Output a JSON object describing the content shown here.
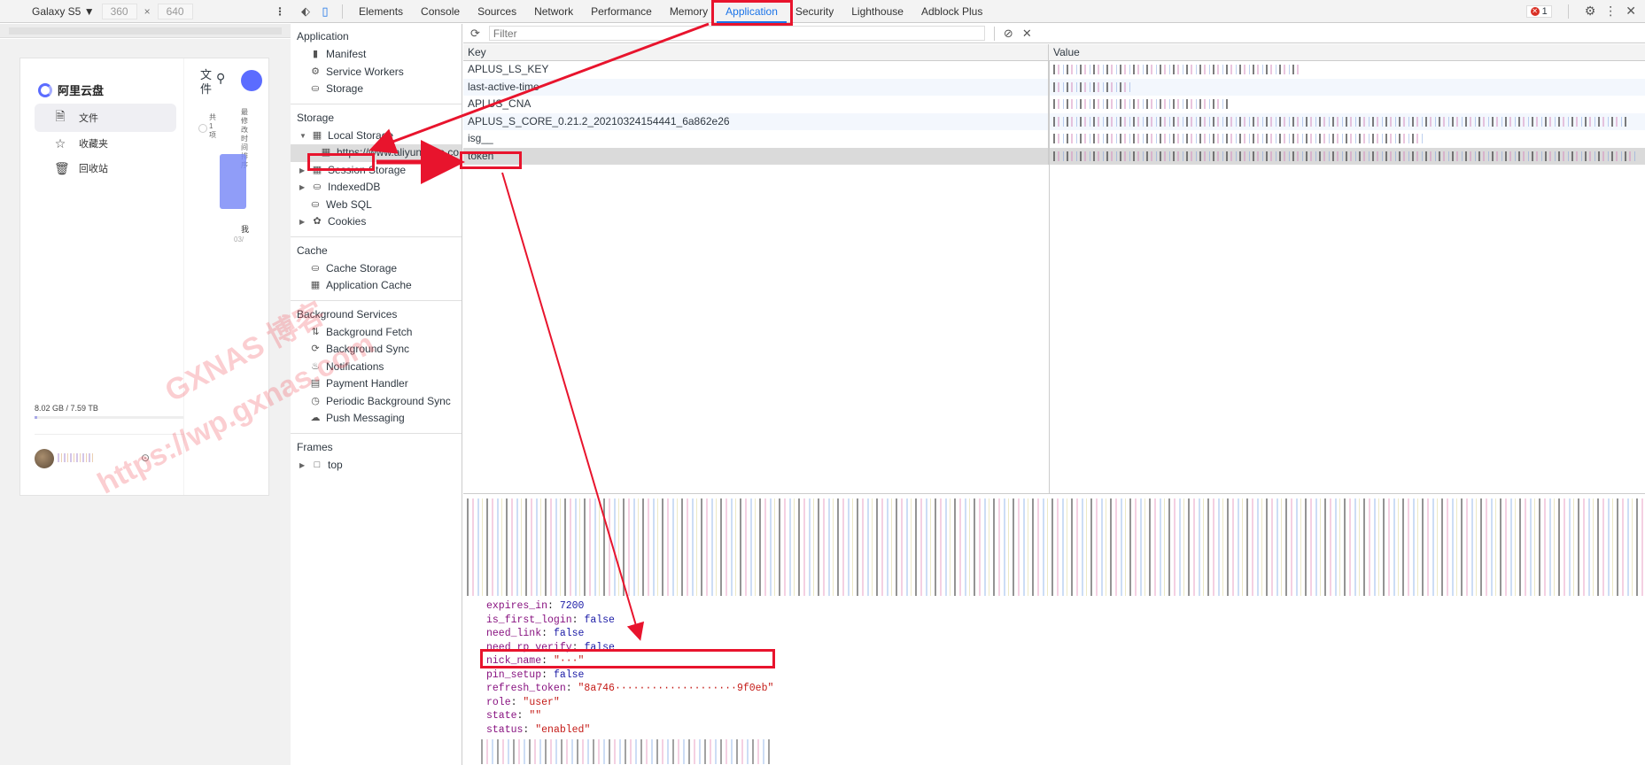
{
  "device_toolbar": {
    "device": "Galaxy S5 ▼",
    "width": "360",
    "times": "×",
    "height": "640",
    "more": "⋮"
  },
  "phone": {
    "brand": "阿里云盘",
    "nav": [
      {
        "label": "文件",
        "icon": "file-icon"
      },
      {
        "label": "收藏夹",
        "icon": "star-icon"
      },
      {
        "label": "回收站",
        "icon": "trash-icon"
      }
    ],
    "header_title": "文件",
    "quota": "8.02 GB / 7.59 TB",
    "quota_fraction": 0.01,
    "side_tiny_a": "共 1 项",
    "side_tiny_b": "最 修 改 时 间 排 序",
    "file_name": "我",
    "file_date": "03/"
  },
  "devtools": {
    "tabs": [
      "Elements",
      "Console",
      "Sources",
      "Network",
      "Performance",
      "Memory",
      "Application",
      "Security",
      "Lighthouse",
      "Adblock Plus"
    ],
    "active_tab": "Application",
    "error_count": "1",
    "sidebar": {
      "application_header": "Application",
      "application_items": [
        {
          "label": "Manifest",
          "icon": "document-icon"
        },
        {
          "label": "Service Workers",
          "icon": "gear-icon"
        },
        {
          "label": "Storage",
          "icon": "database-icon"
        }
      ],
      "storage_header": "Storage",
      "local_storage": "Local Storage",
      "local_storage_origin": "https://www.aliyundrive.co",
      "storage_items": [
        {
          "label": "Session Storage",
          "icon": "grid-icon"
        },
        {
          "label": "IndexedDB",
          "icon": "database-icon"
        },
        {
          "label": "Web SQL",
          "icon": "database-icon"
        },
        {
          "label": "Cookies",
          "icon": "cookie-icon"
        }
      ],
      "cache_header": "Cache",
      "cache_items": [
        {
          "label": "Cache Storage",
          "icon": "database-icon"
        },
        {
          "label": "Application Cache",
          "icon": "grid-icon"
        }
      ],
      "bg_header": "Background Services",
      "bg_items": [
        {
          "label": "Background Fetch",
          "icon": "arrows-icon"
        },
        {
          "label": "Background Sync",
          "icon": "sync-icon"
        },
        {
          "label": "Notifications",
          "icon": "bell-icon"
        },
        {
          "label": "Payment Handler",
          "icon": "card-icon"
        },
        {
          "label": "Periodic Background Sync",
          "icon": "clock-icon"
        },
        {
          "label": "Push Messaging",
          "icon": "cloud-icon"
        }
      ],
      "frames_header": "Frames",
      "frames_top": "top"
    },
    "filter_placeholder": "Filter",
    "table": {
      "col_key": "Key",
      "col_value": "Value",
      "rows": [
        {
          "key": "APLUS_LS_KEY"
        },
        {
          "key": "last-active-time"
        },
        {
          "key": "APLUS_CNA"
        },
        {
          "key": "APLUS_S_CORE_0.21.2_20210324154441_6a862e26"
        },
        {
          "key": "isg__"
        },
        {
          "key": "token"
        }
      ],
      "selected_key": "token"
    },
    "preview_lines": [
      {
        "key": "expires_in",
        "value": "7200",
        "kind": "number"
      },
      {
        "key": "is_first_login",
        "value": "false",
        "kind": "bool"
      },
      {
        "key": "need_link",
        "value": "false",
        "kind": "bool"
      },
      {
        "key": "need_rp_verify",
        "value": "false",
        "kind": "bool"
      },
      {
        "key": "nick_name",
        "value": "\"···\"",
        "kind": "string"
      },
      {
        "key": "pin_setup",
        "value": "false",
        "kind": "bool"
      },
      {
        "key": "refresh_token",
        "value": "\"8a746····················9f0eb\"",
        "kind": "string"
      },
      {
        "key": "role",
        "value": "\"user\"",
        "kind": "string"
      },
      {
        "key": "state",
        "value": "\"\"",
        "kind": "string"
      },
      {
        "key": "status",
        "value": "\"enabled\"",
        "kind": "string"
      }
    ]
  },
  "watermark": {
    "line1": "GXNAS 博客",
    "line2": "https://wp.gxnas.com"
  },
  "colors": {
    "accent": "#1a73e8",
    "annotation": "#e8142d"
  }
}
